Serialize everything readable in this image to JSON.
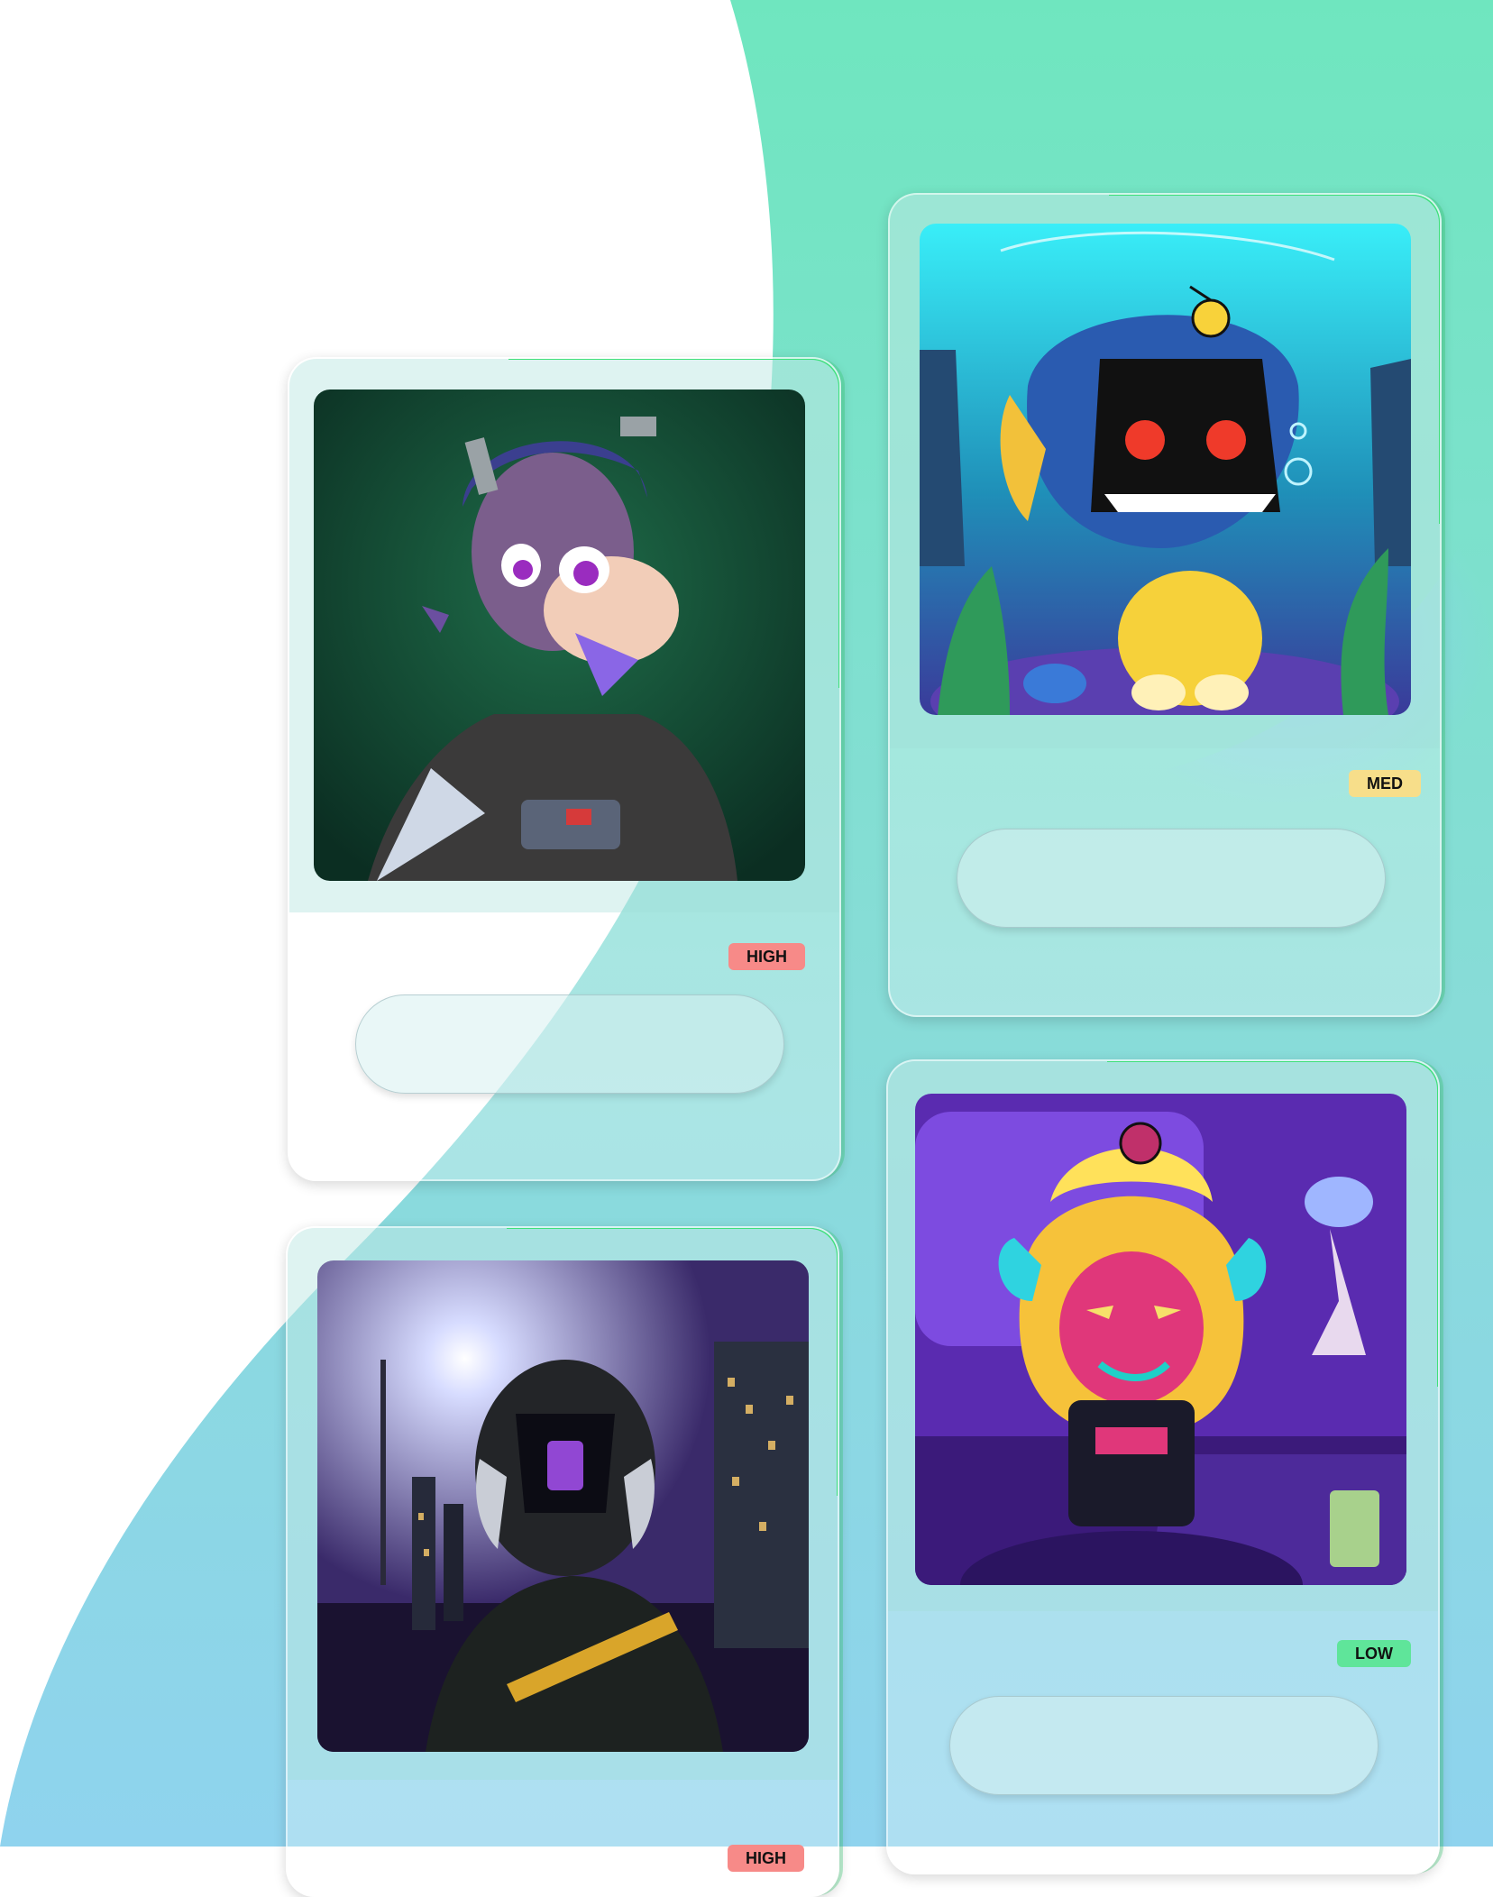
{
  "colors": {
    "gradient_top": "#6fe6bf",
    "gradient_bottom": "#8fd3ee",
    "badge_high": "#f78a88",
    "badge_med": "#f7de8a",
    "badge_low": "#5fe59a",
    "card_border_accent": "#3fe07a"
  },
  "cards": [
    {
      "art": "zebra-ape-character-art",
      "risk_label": "HIGH"
    },
    {
      "art": "anglerfish-cat-character-art",
      "risk_label": "MED"
    },
    {
      "art": "flame-demon-character-art",
      "risk_label": "LOW"
    },
    {
      "art": "helmet-figure-city-night-art",
      "risk_label": "HIGH"
    }
  ]
}
